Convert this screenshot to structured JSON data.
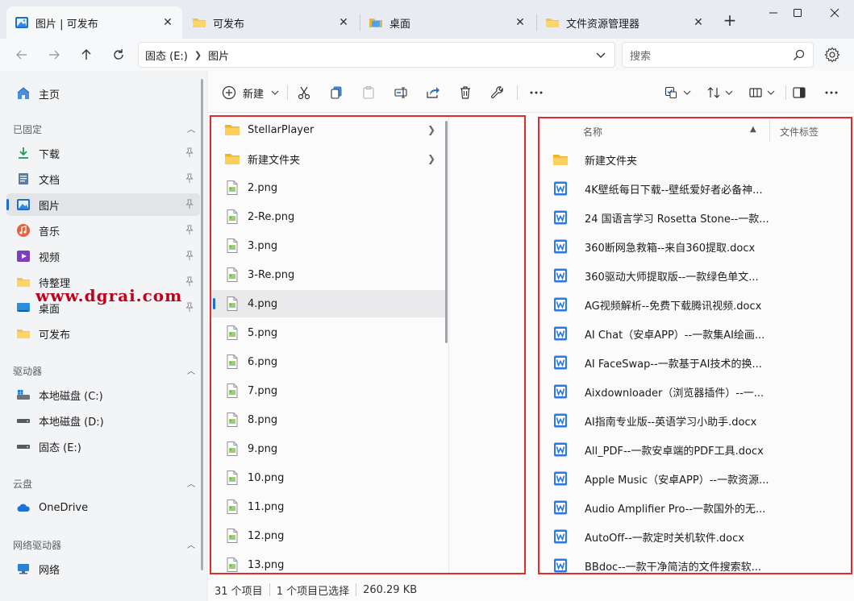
{
  "tabs": [
    {
      "label": "图片 | 可发布",
      "icon": "pictures-folder-icon",
      "active": true
    },
    {
      "label": "可发布",
      "icon": "folder-icon",
      "active": false
    },
    {
      "label": "桌面",
      "icon": "desktop-icon",
      "active": false
    },
    {
      "label": "文件资源管理器",
      "icon": "folder-icon",
      "active": false
    }
  ],
  "window_controls": {
    "new_tab": "+",
    "minimize": "minimize-icon",
    "maximize": "maximize-icon",
    "close": "close-icon"
  },
  "address": {
    "drive": "固态 (E:)",
    "folder": "图片"
  },
  "search": {
    "placeholder": "搜索"
  },
  "sidebar": {
    "home": "主页",
    "pinned_header": "已固定",
    "pinned": [
      "下载",
      "文档",
      "图片",
      "音乐",
      "视频",
      "待整理",
      "桌面",
      "可发布"
    ],
    "drives_header": "驱动器",
    "drives": [
      "本地磁盘 (C:)",
      "本地磁盘 (D:)",
      "固态 (E:)"
    ],
    "cloud_header": "云盘",
    "cloud": [
      "OneDrive"
    ],
    "network_header": "网络驱动器",
    "network": [
      "网络"
    ]
  },
  "watermark": "www.dgrai.com",
  "toolbar": {
    "new_label": "新建"
  },
  "column1": [
    {
      "name": "StellarPlayer",
      "type": "folder"
    },
    {
      "name": "新建文件夹",
      "type": "folder"
    },
    {
      "name": "2.png",
      "type": "png"
    },
    {
      "name": "2-Re.png",
      "type": "png"
    },
    {
      "name": "3.png",
      "type": "png"
    },
    {
      "name": "3-Re.png",
      "type": "png"
    },
    {
      "name": "4.png",
      "type": "png"
    },
    {
      "name": "5.png",
      "type": "png"
    },
    {
      "name": "6.png",
      "type": "png"
    },
    {
      "name": "7.png",
      "type": "png"
    },
    {
      "name": "8.png",
      "type": "png"
    },
    {
      "name": "9.png",
      "type": "png"
    },
    {
      "name": "10.png",
      "type": "png"
    },
    {
      "name": "11.png",
      "type": "png"
    },
    {
      "name": "12.png",
      "type": "png"
    },
    {
      "name": "13.png",
      "type": "png"
    }
  ],
  "details": {
    "col_name": "名称",
    "col_tag": "文件标签",
    "rows": [
      {
        "name": "新建文件夹",
        "type": "folder"
      },
      {
        "name": "4K壁纸每日下载--壁纸爱好者必备神...",
        "type": "docx"
      },
      {
        "name": "24 国语言学习 Rosetta Stone--一款...",
        "type": "docx"
      },
      {
        "name": "360断网急救箱--来自360提取.docx",
        "type": "docx"
      },
      {
        "name": "360驱动大师提取版--一款绿色单文...",
        "type": "docx"
      },
      {
        "name": "AG视频解析--免费下载腾讯视频.docx",
        "type": "docx"
      },
      {
        "name": "AI Chat（安卓APP）--一款集AI绘画...",
        "type": "docx"
      },
      {
        "name": "AI FaceSwap--一款基于AI技术的换...",
        "type": "docx"
      },
      {
        "name": "Aixdownloader（浏览器插件）--一...",
        "type": "docx"
      },
      {
        "name": "AI指南专业版--英语学习小助手.docx",
        "type": "docx"
      },
      {
        "name": "All_PDF--一款安卓端的PDF工具.docx",
        "type": "docx"
      },
      {
        "name": "Apple Music（安卓APP）--一款资源...",
        "type": "docx"
      },
      {
        "name": "Audio Amplifier Pro--一款国外的无...",
        "type": "docx"
      },
      {
        "name": "AutoOff--一款定时关机软件.docx",
        "type": "docx"
      },
      {
        "name": "BBdoc--一款干净简洁的文件搜索软...",
        "type": "docx"
      }
    ]
  },
  "status": {
    "count": "31 个项目",
    "selected": "1 个项目已选择",
    "size": "260.29 KB"
  }
}
